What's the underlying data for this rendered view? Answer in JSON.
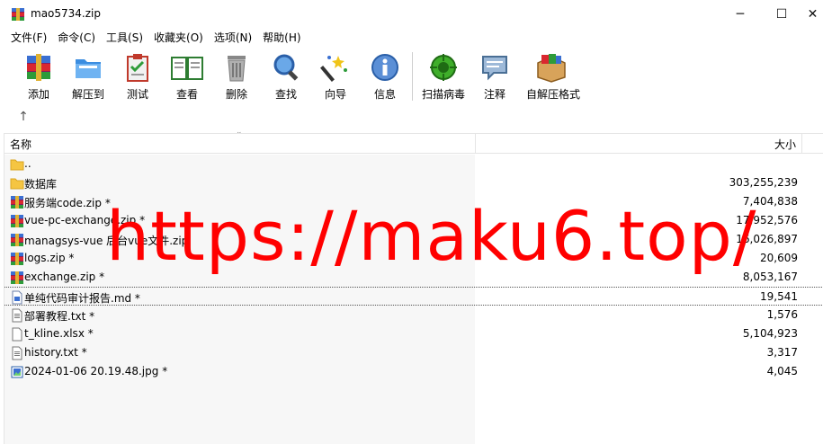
{
  "window": {
    "title": "mao5734.zip",
    "controls": {
      "minimize": "─",
      "maximize": "☐",
      "close": "✕"
    }
  },
  "menu": {
    "items": [
      "文件(F)",
      "命令(C)",
      "工具(S)",
      "收藏夹(O)",
      "选项(N)",
      "帮助(H)"
    ]
  },
  "toolbar": {
    "add": "添加",
    "extract_to": "解压到",
    "test": "测试",
    "view": "查看",
    "delete": "删除",
    "find": "查找",
    "wizard": "向导",
    "info": "信息",
    "scan": "扫描病毒",
    "comment": "注释",
    "sfx": "自解压格式"
  },
  "pathbar": {
    "up": "↑"
  },
  "list": {
    "columns": {
      "name": "名称",
      "size": "大小"
    },
    "rows": [
      {
        "name": "..",
        "size": "",
        "icon": "folder-icon"
      },
      {
        "name": "数据库",
        "size": "303,255,239",
        "icon": "folder-icon"
      },
      {
        "name": "服务端code.zip *",
        "size": "7,404,838",
        "icon": "archive-icon"
      },
      {
        "name": "vue-pc-exchange.zip *",
        "size": "17,952,576",
        "icon": "archive-icon"
      },
      {
        "name": "managsys-vue 后台vue文件.zip",
        "size": "16,026,897",
        "icon": "archive-icon"
      },
      {
        "name": "logs.zip *",
        "size": "20,609",
        "icon": "archive-icon"
      },
      {
        "name": "exchange.zip *",
        "size": "8,053,167",
        "icon": "archive-icon"
      },
      {
        "name": "单纯代码审计报告.md *",
        "size": "19,541",
        "icon": "markdown-file-icon"
      },
      {
        "name": "部署教程.txt *",
        "size": "1,576",
        "icon": "text-file-icon"
      },
      {
        "name": "t_kline.xlsx *",
        "size": "5,104,923",
        "icon": "blank-file-icon"
      },
      {
        "name": "history.txt *",
        "size": "3,317",
        "icon": "text-file-icon"
      },
      {
        "name": "2024-01-06 20.19.48.jpg *",
        "size": "4,045",
        "icon": "image-file-icon"
      }
    ]
  },
  "watermark": {
    "text": "https://maku6.top/"
  },
  "colors": {
    "watermark": "#ff0000",
    "folder": "#f5c542",
    "accent": "#0063b1"
  }
}
